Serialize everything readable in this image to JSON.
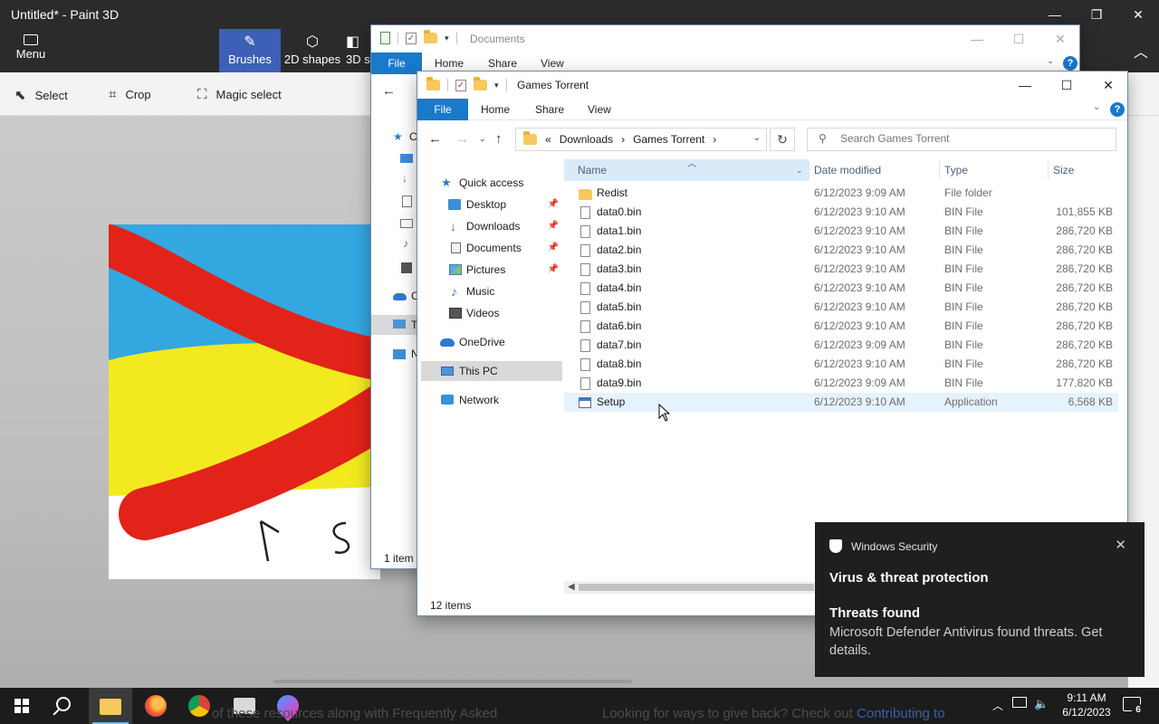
{
  "paint": {
    "title": "Untitled* - Paint 3D",
    "menu_label": "Menu",
    "tools": [
      {
        "label": "Brushes"
      },
      {
        "label": "2D shapes"
      },
      {
        "label": "3D s"
      }
    ],
    "toolbar": {
      "select": "Select",
      "crop": "Crop",
      "magic_select": "Magic select"
    }
  },
  "back_window": {
    "title": "Documents",
    "tabs": {
      "file": "File",
      "home": "Home",
      "share": "Share",
      "view": "View"
    },
    "nav_partial": [
      "C",
      "",
      "",
      "",
      "",
      "",
      "C",
      "T",
      "N"
    ],
    "status": "1 item"
  },
  "front_window": {
    "title": "Games Torrent",
    "tabs": {
      "file": "File",
      "home": "Home",
      "share": "Share",
      "view": "View"
    },
    "address": {
      "lead": "«",
      "crumbs": [
        "Downloads",
        "Games Torrent"
      ],
      "sep": "›"
    },
    "search_placeholder": "Search Games Torrent",
    "nav": {
      "quick_access": "Quick access",
      "desktop": "Desktop",
      "downloads": "Downloads",
      "documents": "Documents",
      "pictures": "Pictures",
      "music": "Music",
      "videos": "Videos",
      "onedrive": "OneDrive",
      "this_pc": "This PC",
      "network": "Network"
    },
    "columns": {
      "name": "Name",
      "date": "Date modified",
      "type": "Type",
      "size": "Size"
    },
    "files": [
      {
        "name": "Redist",
        "date": "6/12/2023 9:09 AM",
        "type": "File folder",
        "size": "",
        "icon": "folder-icon"
      },
      {
        "name": "data0.bin",
        "date": "6/12/2023 9:10 AM",
        "type": "BIN File",
        "size": "101,855 KB",
        "icon": "file-icon"
      },
      {
        "name": "data1.bin",
        "date": "6/12/2023 9:10 AM",
        "type": "BIN File",
        "size": "286,720 KB",
        "icon": "file-icon"
      },
      {
        "name": "data2.bin",
        "date": "6/12/2023 9:10 AM",
        "type": "BIN File",
        "size": "286,720 KB",
        "icon": "file-icon"
      },
      {
        "name": "data3.bin",
        "date": "6/12/2023 9:10 AM",
        "type": "BIN File",
        "size": "286,720 KB",
        "icon": "file-icon"
      },
      {
        "name": "data4.bin",
        "date": "6/12/2023 9:10 AM",
        "type": "BIN File",
        "size": "286,720 KB",
        "icon": "file-icon"
      },
      {
        "name": "data5.bin",
        "date": "6/12/2023 9:10 AM",
        "type": "BIN File",
        "size": "286,720 KB",
        "icon": "file-icon"
      },
      {
        "name": "data6.bin",
        "date": "6/12/2023 9:10 AM",
        "type": "BIN File",
        "size": "286,720 KB",
        "icon": "file-icon"
      },
      {
        "name": "data7.bin",
        "date": "6/12/2023 9:09 AM",
        "type": "BIN File",
        "size": "286,720 KB",
        "icon": "file-icon"
      },
      {
        "name": "data8.bin",
        "date": "6/12/2023 9:10 AM",
        "type": "BIN File",
        "size": "286,720 KB",
        "icon": "file-icon"
      },
      {
        "name": "data9.bin",
        "date": "6/12/2023 9:09 AM",
        "type": "BIN File",
        "size": "177,820 KB",
        "icon": "file-icon"
      },
      {
        "name": "Setup",
        "date": "6/12/2023 9:10 AM",
        "type": "Application",
        "size": "6,568 KB",
        "icon": "app-icon"
      }
    ],
    "status": "12 items"
  },
  "toast": {
    "app": "Windows Security",
    "title": "Virus & threat protection",
    "heading": "Threats found",
    "body": "Microsoft Defender Antivirus found threats. Get details."
  },
  "taskbar": {
    "ghost_text_left": "of these resources along with Frequently Asked",
    "ghost_text_right": "Looking for ways to give back? Check out",
    "ghost_link": "Contributing to",
    "time": "9:11 AM",
    "date": "6/12/2023",
    "notification_count": "6",
    "accent": "#76b9ed"
  },
  "colors": {
    "accent": "#1979ca",
    "selection": "#e5f3ff",
    "toast_bg": "#1f1f1f"
  }
}
